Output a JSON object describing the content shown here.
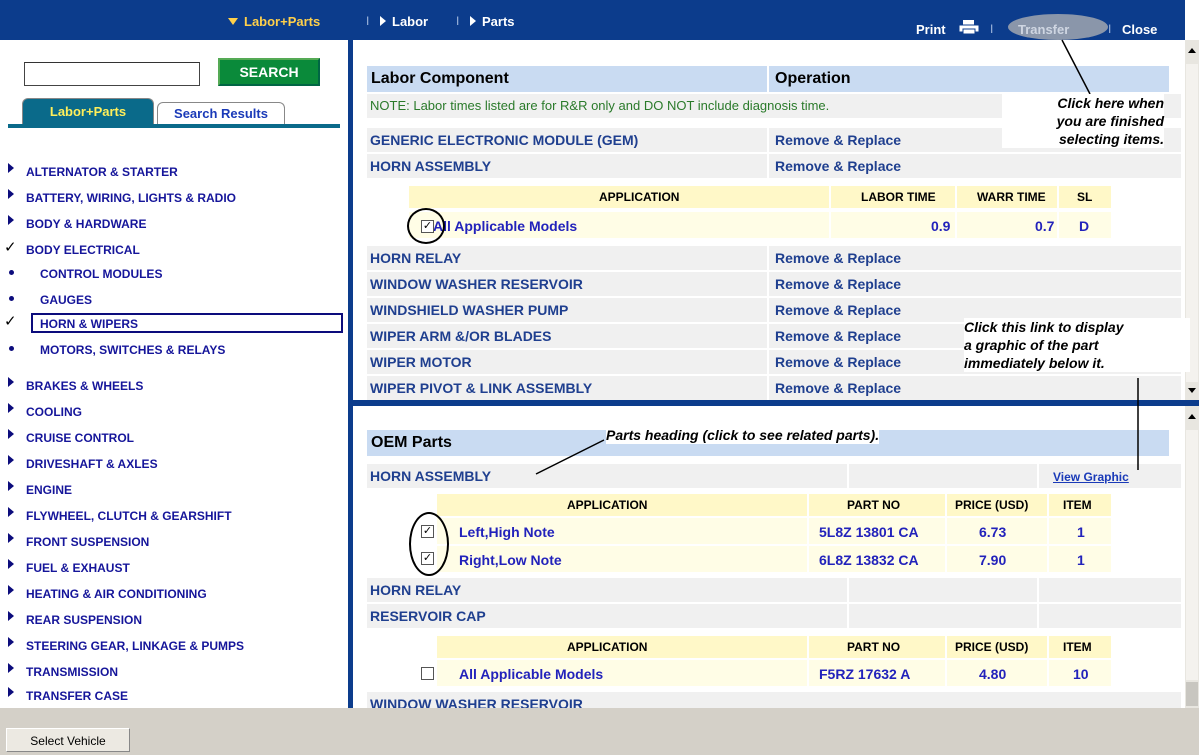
{
  "topnav": {
    "labor_parts": "Labor+Parts",
    "labor": "Labor",
    "parts": "Parts",
    "sep": "I",
    "print": "Print",
    "transfer": "Transfer",
    "close": "Close"
  },
  "search": {
    "button": "SEARCH",
    "value": ""
  },
  "tabs": {
    "active": "Labor+Parts",
    "other": "Search Results"
  },
  "nav": {
    "items": [
      "ALTERNATOR & STARTER",
      "BATTERY, WIRING, LIGHTS & RADIO",
      "BODY & HARDWARE",
      "BODY ELECTRICAL",
      "CONTROL MODULES",
      "GAUGES",
      "HORN & WIPERS",
      "MOTORS, SWITCHES & RELAYS",
      "BRAKES & WHEELS",
      "COOLING",
      "CRUISE CONTROL",
      "DRIVESHAFT & AXLES",
      "ENGINE",
      "FLYWHEEL, CLUTCH & GEARSHIFT",
      "FRONT SUSPENSION",
      "FUEL & EXHAUST",
      "HEATING & AIR CONDITIONING",
      "REAR SUSPENSION",
      "STEERING GEAR, LINKAGE & PUMPS",
      "TRANSMISSION",
      "TRANSFER CASE"
    ],
    "check": "✓"
  },
  "labor": {
    "header_component": "Labor Component",
    "header_operation": "Operation",
    "note": "NOTE: Labor times listed are for R&R only and DO NOT include diagnosis time.",
    "rows": [
      {
        "component": "GENERIC ELECTRONIC MODULE (GEM)",
        "operation": "Remove & Replace"
      },
      {
        "component": "HORN ASSEMBLY",
        "operation": "Remove & Replace"
      },
      {
        "component": "HORN RELAY",
        "operation": "Remove & Replace"
      },
      {
        "component": "WINDOW WASHER RESERVOIR",
        "operation": "Remove & Replace"
      },
      {
        "component": "WINDSHIELD WASHER PUMP",
        "operation": "Remove & Replace"
      },
      {
        "component": "WIPER ARM &/OR BLADES",
        "operation": "Remove & Replace"
      },
      {
        "component": "WIPER MOTOR",
        "operation": "Remove & Replace"
      },
      {
        "component": "WIPER PIVOT & LINK ASSEMBLY",
        "operation": "Remove & Replace"
      }
    ],
    "app_header": {
      "application": "APPLICATION",
      "labor_time": "LABOR TIME",
      "warr_time": "WARR TIME",
      "sl": "SL"
    },
    "app_row": {
      "model": "All Applicable Models",
      "labor_time": "0.9",
      "warr_time": "0.7",
      "sl": "D",
      "checked": "✓"
    }
  },
  "parts": {
    "header": "OEM Parts",
    "horn_assembly": "HORN ASSEMBLY",
    "view_graphic": "View Graphic",
    "app_header": {
      "application": "APPLICATION",
      "part_no": "PART NO",
      "price": "PRICE (USD)",
      "item": "ITEM"
    },
    "horn_rows": [
      {
        "app": "Left,High Note",
        "part_no": "5L8Z 13801 CA",
        "price": "6.73",
        "item": "1",
        "checked": "✓"
      },
      {
        "app": "Right,Low Note",
        "part_no": "6L8Z 13832 CA",
        "price": "7.90",
        "item": "1",
        "checked": "✓"
      }
    ],
    "horn_relay": "HORN RELAY",
    "reservoir_cap": "RESERVOIR CAP",
    "cap_row": {
      "app": "All Applicable Models",
      "part_no": "F5RZ 17632 A",
      "price": "4.80",
      "item": "10"
    },
    "window_washer": "WINDOW WASHER RESERVOIR"
  },
  "callouts": {
    "transfer_l1": "Click here when",
    "transfer_l2": "you are finished",
    "transfer_l3": "selecting items.",
    "graphic_l1": "Click this link to display",
    "graphic_l2": "a graphic of the part",
    "graphic_l3": "immediately below it.",
    "parts_heading": "Parts heading (click to see related parts)."
  },
  "bottom": {
    "select_vehicle": "Select Vehicle"
  }
}
